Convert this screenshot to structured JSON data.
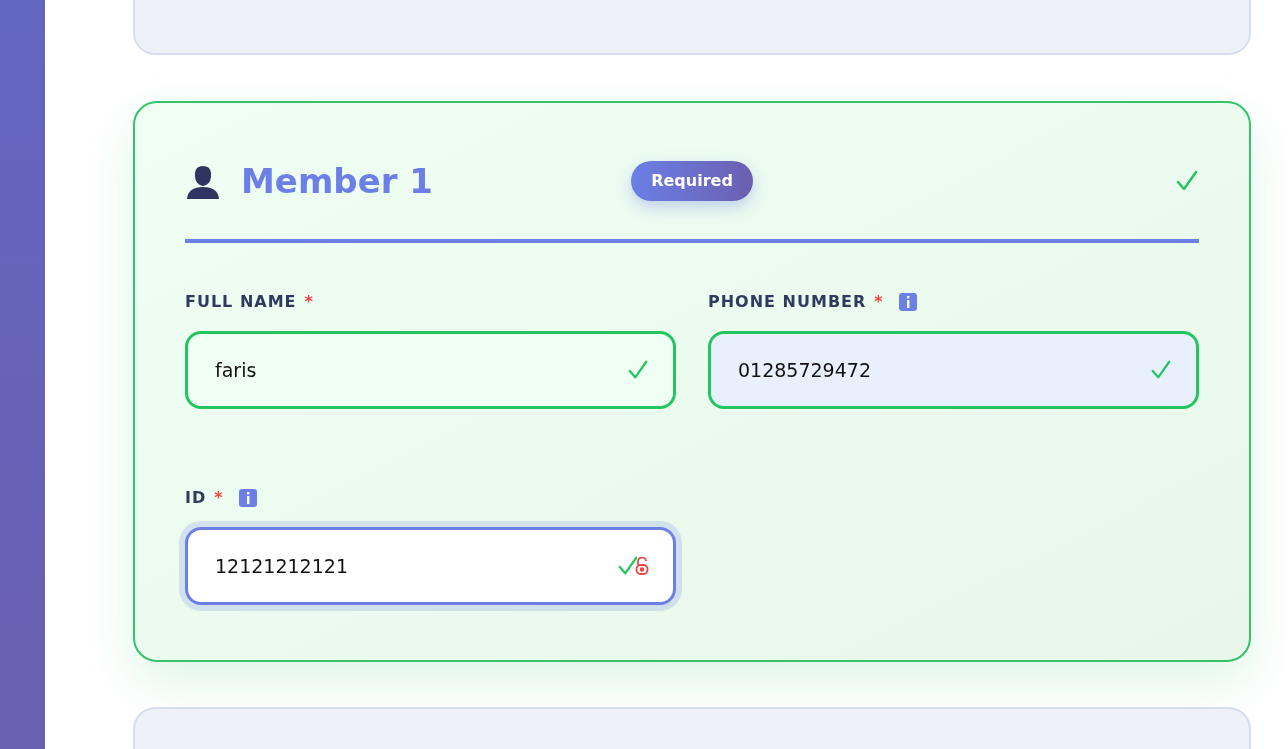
{
  "member_card": {
    "title": "Member 1",
    "badge": "Required",
    "complete": true,
    "fields": [
      {
        "label": "FULL NAME",
        "required_mark": "*",
        "info": false,
        "value": "faris",
        "valid": true,
        "focused": false,
        "autofilled": false,
        "locked": false
      },
      {
        "label": "PHONE NUMBER",
        "required_mark": "*",
        "info": true,
        "value": "01285729472",
        "valid": true,
        "focused": false,
        "autofilled": true,
        "locked": false
      },
      {
        "label": "ID",
        "required_mark": "*",
        "info": true,
        "value": "12121212121",
        "valid": true,
        "focused": true,
        "autofilled": false,
        "locked": true
      }
    ]
  }
}
